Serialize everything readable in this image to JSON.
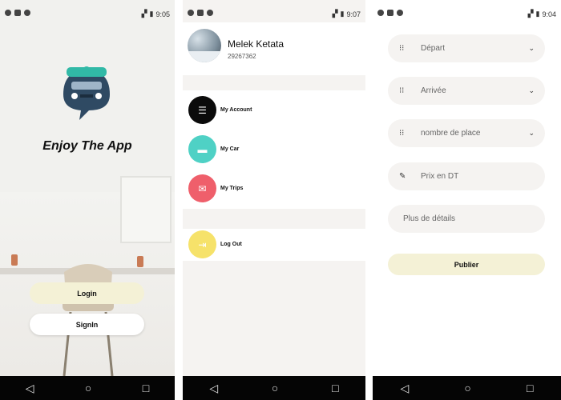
{
  "screens": {
    "welcome": {
      "status_time": "9:05",
      "tagline": "Enjoy The App",
      "login_label": "Login",
      "signin_label": "SignIn"
    },
    "menu": {
      "status_time": "9:07",
      "user_name": "Melek Ketata",
      "user_phone": "29267362",
      "items": [
        {
          "label": "My Account",
          "icon": "list-icon",
          "color": "#0b0b0b"
        },
        {
          "label": "My Car",
          "icon": "car-icon",
          "color": "#4fd1c5"
        },
        {
          "label": "My Trips",
          "icon": "mail-icon",
          "color": "#ef5f6b"
        },
        {
          "label": "Log Out",
          "icon": "logout-icon",
          "color": "#f6e26a"
        }
      ]
    },
    "publish": {
      "status_time": "9:04",
      "depart_placeholder": "Départ",
      "arrivee_placeholder": "Arrivée",
      "places_placeholder": "nombre de place",
      "price_placeholder": "Prix en DT",
      "details_placeholder": "Plus de détails",
      "publish_label": "Publier"
    }
  },
  "colors": {
    "accent_button": "#f4f1d6",
    "logo_teal": "#31b9a6",
    "logo_navy": "#2f4a63"
  }
}
